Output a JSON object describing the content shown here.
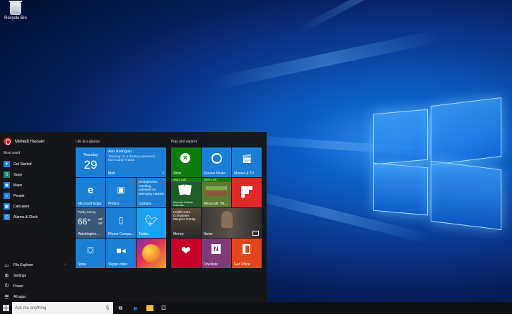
{
  "desktop": {
    "recycle_bin_label": "Recycle Bin"
  },
  "start_menu": {
    "user_name": "Mehedi Hassan",
    "most_used_label": "Most used",
    "most_used": [
      {
        "label": "Get Started",
        "icon": "lightbulb-icon",
        "color": "#1f7fde"
      },
      {
        "label": "Sway",
        "icon": "sway-icon",
        "color": "#0f8a6c"
      },
      {
        "label": "Maps",
        "icon": "maps-icon",
        "color": "#1f7fde"
      },
      {
        "label": "People",
        "icon": "people-icon",
        "color": "#1f7fde"
      },
      {
        "label": "Calculator",
        "icon": "calculator-icon",
        "color": "#1f7fde"
      },
      {
        "label": "Alarms & Clock",
        "icon": "alarm-icon",
        "color": "#1f7fde"
      }
    ],
    "bottom": [
      {
        "label": "File Explorer",
        "icon": "folder-icon"
      },
      {
        "label": "Settings",
        "icon": "gear-icon"
      },
      {
        "label": "Power",
        "icon": "power-icon"
      },
      {
        "label": "All apps",
        "icon": "all-apps-icon"
      }
    ],
    "life_label": "Life at a glance",
    "play_label": "Play and explore",
    "tiles": {
      "calendar": {
        "day": "Thursday",
        "date": "29"
      },
      "mail": {
        "sender": "Alex Rodriguez",
        "snippet": "Tracking 10, a driving experience from Game Tracks",
        "label": "Mail",
        "count": "2"
      },
      "edge": {
        "label": "Microsoft Edge"
      },
      "photos": {
        "label": "Photos"
      },
      "cortana": {
        "text": "Smartphones reaching saturation in emerging markets",
        "label": "Cortana"
      },
      "weather": {
        "condition": "Partly Sunny",
        "temp": "66°",
        "high": "69°",
        "low": "55°",
        "city": "Washington..."
      },
      "phone": {
        "label": "Phone Compa..."
      },
      "twitter": {
        "label": "Twitter"
      },
      "store": {
        "label": "Store"
      },
      "skype": {
        "label": "Skype video"
      },
      "candy": {
        "label": ""
      },
      "xbox": {
        "label": "Xbox"
      },
      "groove": {
        "label": "Groove Music"
      },
      "movies": {
        "label": "Movies & TV"
      },
      "solitaire": {
        "badge": "XBOX LIVE",
        "label": "Microsoft Solitaire Collection"
      },
      "minecraft": {
        "badge": "XBOX LIVE",
        "label": "Minecraft: Wi..."
      },
      "flipboard": {
        "label": ""
      },
      "money": {
        "text": "Health Care Companies Mergers Trendy",
        "label": "Money"
      },
      "news": {
        "label": "News"
      },
      "iheart": {
        "label": ""
      },
      "onenote": {
        "label": "OneNote"
      },
      "office": {
        "label": "Get Office"
      }
    }
  },
  "taskbar": {
    "search_placeholder": "Ask me anything"
  },
  "colors": {
    "tile_blue": "#1c7fd6",
    "xbox_green": "#107c10",
    "flipboard_red": "#e12828",
    "onenote_purple": "#80397b",
    "office_orange": "#e3451e",
    "iheart_red": "#c6002b"
  }
}
